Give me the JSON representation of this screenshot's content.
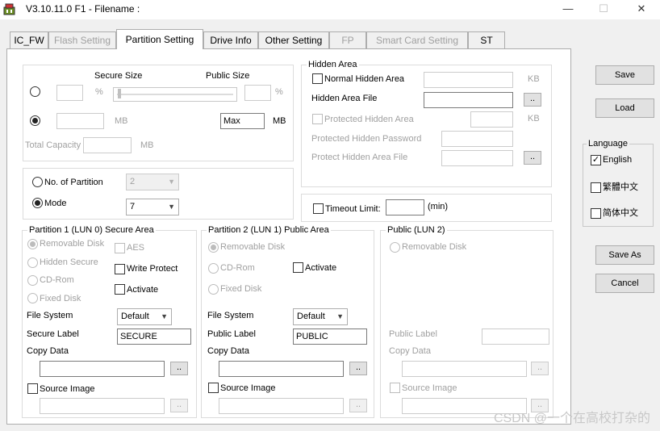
{
  "window": {
    "title": "V3.10.11.0 F1 - Filename :",
    "controls": {
      "minimize": "—",
      "maximize": "☐",
      "close": "✕"
    }
  },
  "tabs": [
    {
      "label": "IC_FW",
      "state": "normal"
    },
    {
      "label": "Flash Setting",
      "state": "disabled"
    },
    {
      "label": "Partition Setting",
      "state": "active"
    },
    {
      "label": "Drive Info",
      "state": "normal"
    },
    {
      "label": "Other Setting",
      "state": "normal"
    },
    {
      "label": "FP",
      "state": "disabled"
    },
    {
      "label": "Smart Card Setting",
      "state": "disabled"
    },
    {
      "label": "ST",
      "state": "normal"
    }
  ],
  "capacity": {
    "secure_size_label": "Secure Size",
    "public_size_label": "Public Size",
    "percent_unit": "%",
    "mb_unit": "MB",
    "public_value": "Max",
    "total_capacity_label": "Total Capacity"
  },
  "partition_count": {
    "no_of_partition_label": "No. of Partition",
    "no_of_partition_value": "2",
    "mode_label": "Mode",
    "mode_value": "7"
  },
  "hidden_area": {
    "title": "Hidden Area",
    "normal_hidden_area_label": "Normal Hidden Area",
    "kb_unit": "KB",
    "hidden_area_file_label": "Hidden Area File",
    "protected_hidden_area_label": "Protected Hidden Area",
    "protected_hidden_password_label": "Protected Hidden Password",
    "protect_hidden_area_file_label": "Protect Hidden Area File",
    "browse": ".."
  },
  "timeout": {
    "label": "Timeout Limit:",
    "unit": "(min)"
  },
  "partition1": {
    "title": "Partition 1 (LUN 0) Secure Area",
    "removable_disk": "Removable Disk",
    "hidden_secure": "Hidden Secure",
    "cd_rom": "CD-Rom",
    "fixed_disk": "Fixed Disk",
    "aes": "AES",
    "write_protect": "Write Protect",
    "activate": "Activate",
    "file_system_label": "File System",
    "file_system_value": "Default",
    "label_label": "Secure Label",
    "label_value": "SECURE",
    "copy_data_label": "Copy Data",
    "source_image_label": "Source Image",
    "browse": ".."
  },
  "partition2": {
    "title": "Partition 2 (LUN 1) Public Area",
    "removable_disk": "Removable Disk",
    "cd_rom": "CD-Rom",
    "fixed_disk": "Fixed Disk",
    "activate": "Activate",
    "file_system_label": "File System",
    "file_system_value": "Default",
    "label_label": "Public Label",
    "label_value": "PUBLIC",
    "copy_data_label": "Copy Data",
    "source_image_label": "Source Image",
    "browse": ".."
  },
  "public_lun2": {
    "title": "Public (LUN 2)",
    "removable_disk": "Removable Disk",
    "label_label": "Public Label",
    "copy_data_label": "Copy Data",
    "source_image_label": "Source Image",
    "browse": ".."
  },
  "side": {
    "save": "Save",
    "load": "Load",
    "language_title": "Language",
    "languages": [
      {
        "label": "English",
        "checked": true
      },
      {
        "label": "繁體中文",
        "checked": false
      },
      {
        "label": "简体中文",
        "checked": false
      }
    ],
    "save_as": "Save As",
    "cancel": "Cancel"
  },
  "watermark": "CSDN @一个在高校打杂的"
}
